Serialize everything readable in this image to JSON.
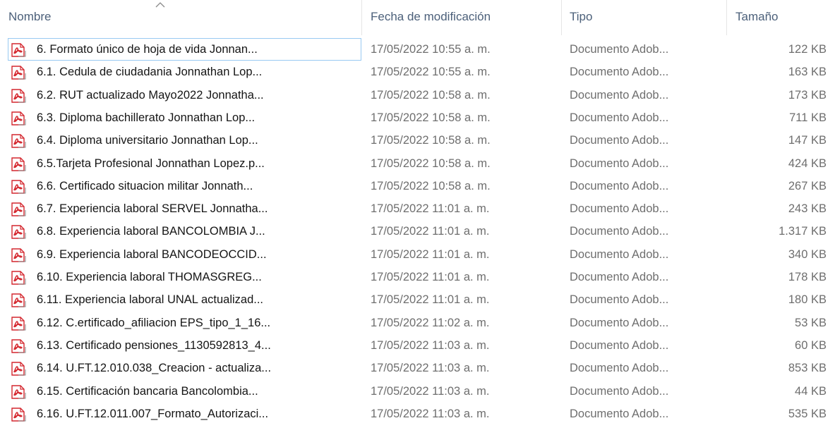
{
  "columns": {
    "name": "Nombre",
    "date": "Fecha de modificación",
    "type": "Tipo",
    "size": "Tamaño"
  },
  "sort": {
    "column": "name",
    "direction": "ascending",
    "icon": "chevron-up-icon"
  },
  "accent": {
    "selection_border": "#99c9f2",
    "pdf_red": "#d4272e"
  },
  "files": [
    {
      "name": "6. Formato único de hoja de vida Jonnan...",
      "date": "17/05/2022 10:55 a. m.",
      "type": "Documento Adob...",
      "size": "122 KB",
      "icon": "pdf-file-icon",
      "selected": true
    },
    {
      "name": "6.1. Cedula de ciudadania Jonnathan Lop...",
      "date": "17/05/2022 10:55 a. m.",
      "type": "Documento Adob...",
      "size": "163 KB",
      "icon": "pdf-file-icon"
    },
    {
      "name": "6.2. RUT actualizado Mayo2022 Jonnatha...",
      "date": "17/05/2022 10:58 a. m.",
      "type": "Documento Adob...",
      "size": "173 KB",
      "icon": "pdf-file-icon"
    },
    {
      "name": "6.3. Diploma bachillerato Jonnathan Lop...",
      "date": "17/05/2022 10:58 a. m.",
      "type": "Documento Adob...",
      "size": "711 KB",
      "icon": "pdf-file-icon"
    },
    {
      "name": "6.4. Diploma universitario Jonnathan Lop...",
      "date": "17/05/2022 10:58 a. m.",
      "type": "Documento Adob...",
      "size": "147 KB",
      "icon": "pdf-file-icon"
    },
    {
      "name": "6.5.Tarjeta Profesional Jonnathan Lopez.p...",
      "date": "17/05/2022 10:58 a. m.",
      "type": "Documento Adob...",
      "size": "424 KB",
      "icon": "pdf-file-icon"
    },
    {
      "name": "6.6. Certificado situacion militar Jonnath...",
      "date": "17/05/2022 10:58 a. m.",
      "type": "Documento Adob...",
      "size": "267 KB",
      "icon": "pdf-file-icon"
    },
    {
      "name": "6.7. Experiencia laboral SERVEL Jonnatha...",
      "date": "17/05/2022 11:01 a. m.",
      "type": "Documento Adob...",
      "size": "243 KB",
      "icon": "pdf-file-icon"
    },
    {
      "name": "6.8. Experiencia laboral BANCOLOMBIA J...",
      "date": "17/05/2022 11:01 a. m.",
      "type": "Documento Adob...",
      "size": "1.317 KB",
      "icon": "pdf-file-icon"
    },
    {
      "name": "6.9. Experiencia laboral BANCODEOCCID...",
      "date": "17/05/2022 11:01 a. m.",
      "type": "Documento Adob...",
      "size": "340 KB",
      "icon": "pdf-file-icon"
    },
    {
      "name": "6.10.  Experiencia laboral THOMASGREG...",
      "date": "17/05/2022 11:01 a. m.",
      "type": "Documento Adob...",
      "size": "178 KB",
      "icon": "pdf-file-icon"
    },
    {
      "name": "6.11. Experiencia laboral UNAL actualizad...",
      "date": "17/05/2022 11:01 a. m.",
      "type": "Documento Adob...",
      "size": "180 KB",
      "icon": "pdf-file-icon"
    },
    {
      "name": "6.12. C.ertificado_afiliacion EPS_tipo_1_16...",
      "date": "17/05/2022 11:02 a. m.",
      "type": "Documento Adob...",
      "size": "53 KB",
      "icon": "pdf-file-icon"
    },
    {
      "name": "6.13. Certificado pensiones_1130592813_4...",
      "date": "17/05/2022 11:03 a. m.",
      "type": "Documento Adob...",
      "size": "60 KB",
      "icon": "pdf-file-icon"
    },
    {
      "name": "6.14. U.FT.12.010.038_Creacion - actualiza...",
      "date": "17/05/2022 11:03 a. m.",
      "type": "Documento Adob...",
      "size": "853 KB",
      "icon": "pdf-file-icon"
    },
    {
      "name": "6.15. Certificación bancaria Bancolombia...",
      "date": "17/05/2022 11:03 a. m.",
      "type": "Documento Adob...",
      "size": "44 KB",
      "icon": "pdf-file-icon"
    },
    {
      "name": "6.16. U.FT.12.011.007_Formato_Autorizaci...",
      "date": "17/05/2022 11:03 a. m.",
      "type": "Documento Adob...",
      "size": "535 KB",
      "icon": "pdf-file-icon"
    }
  ]
}
